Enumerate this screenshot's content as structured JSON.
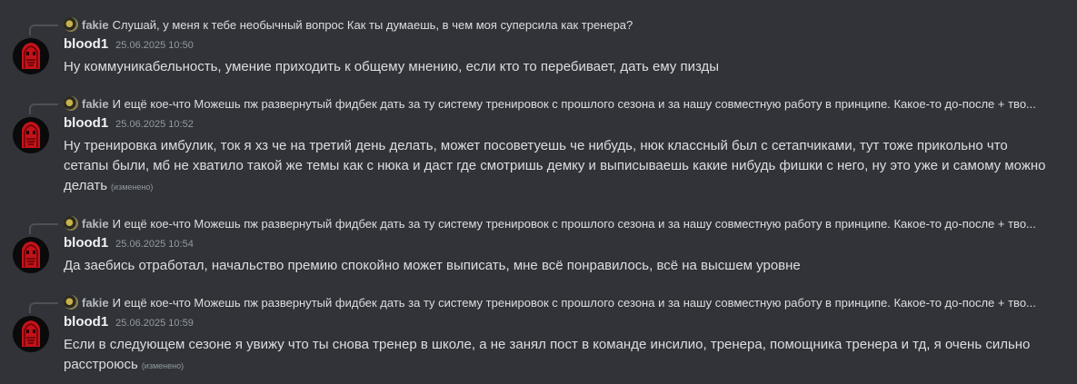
{
  "messages": [
    {
      "reply": {
        "author": "fakie",
        "text": "Слушай, у меня к тебе необычный вопрос Как ты думаешь, в чем моя суперсила как тренера?"
      },
      "author": "blood1",
      "timestamp": "25.06.2025 10:50",
      "text": "Ну коммуникабельность, умение приходить к общему мнению, если кто то перебивает, дать ему пизды",
      "edited": ""
    },
    {
      "reply": {
        "author": "fakie",
        "text": "И ещё кое-что Можешь пж развернутый фидбек дать за ту систему тренировок с прошлого сезона и за нашу совместную работу в принципе. Какое-то до-после + тво..."
      },
      "author": "blood1",
      "timestamp": "25.06.2025 10:52",
      "text": "Ну тренировка имбулик, ток я хз че на третий день делать, может посоветуешь че нибудь, нюк классный был с сетапчиками, тут тоже прикольно что сетапы были, мб не хватило такой же темы как с нюка и даст где смотришь демку и выписываешь какие нибудь фишки с него, ну это уже и самому можно делать",
      "edited": "(изменено)"
    },
    {
      "reply": {
        "author": "fakie",
        "text": "И ещё кое-что Можешь пж развернутый фидбек дать за ту систему тренировок с прошлого сезона и за нашу совместную работу в принципе. Какое-то до-после + тво..."
      },
      "author": "blood1",
      "timestamp": "25.06.2025 10:54",
      "text": "Да заебись отработал, начальство премию спокойно может выписать, мне всё понравилось, всё на высшем уровне",
      "edited": ""
    },
    {
      "reply": {
        "author": "fakie",
        "text": "И ещё кое-что Можешь пж развернутый фидбек дать за ту систему тренировок с прошлого сезона и за нашу совместную работу в принципе. Какое-то до-после + тво..."
      },
      "author": "blood1",
      "timestamp": "25.06.2025 10:59",
      "text": "Если в следующем сезоне я увижу что ты снова тренер в школе, а не занял пост в команде инсилио, тренера, помощника тренера и тд, я очень сильно расстроюсь",
      "edited": "(изменено)"
    }
  ],
  "colors": {
    "background": "#313338",
    "text": "#dbdee1",
    "muted": "#949ba4",
    "author": "#f2f3f5",
    "avatar_red": "#c3121a"
  }
}
